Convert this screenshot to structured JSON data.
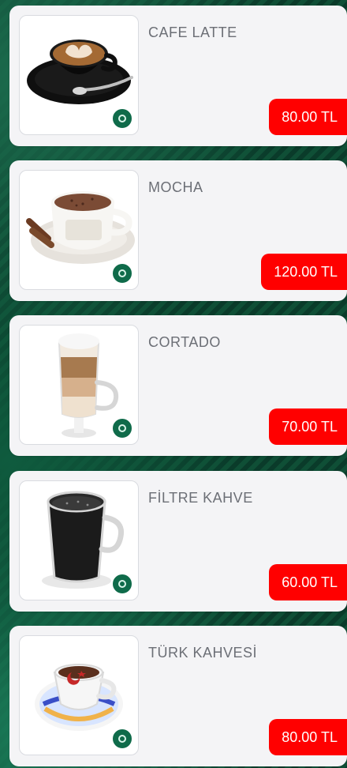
{
  "products": [
    {
      "name": "CAFE LATTE",
      "price": "80.00 TL",
      "image_icon": "latte-cup-image"
    },
    {
      "name": "MOCHA",
      "price": "120.00 TL",
      "image_icon": "mocha-cup-image"
    },
    {
      "name": "CORTADO",
      "price": "70.00 TL",
      "image_icon": "cortado-glass-image"
    },
    {
      "name": "FİLTRE KAHVE",
      "price": "60.00 TL",
      "image_icon": "filter-coffee-mug-image"
    },
    {
      "name": "TÜRK KAHVESİ",
      "price": "80.00 TL",
      "image_icon": "turkish-coffee-cup-image"
    }
  ],
  "colors": {
    "price_bg": "#ff0000",
    "card_bg": "#f4f4f6",
    "badge_bg": "#0f6b4a"
  }
}
